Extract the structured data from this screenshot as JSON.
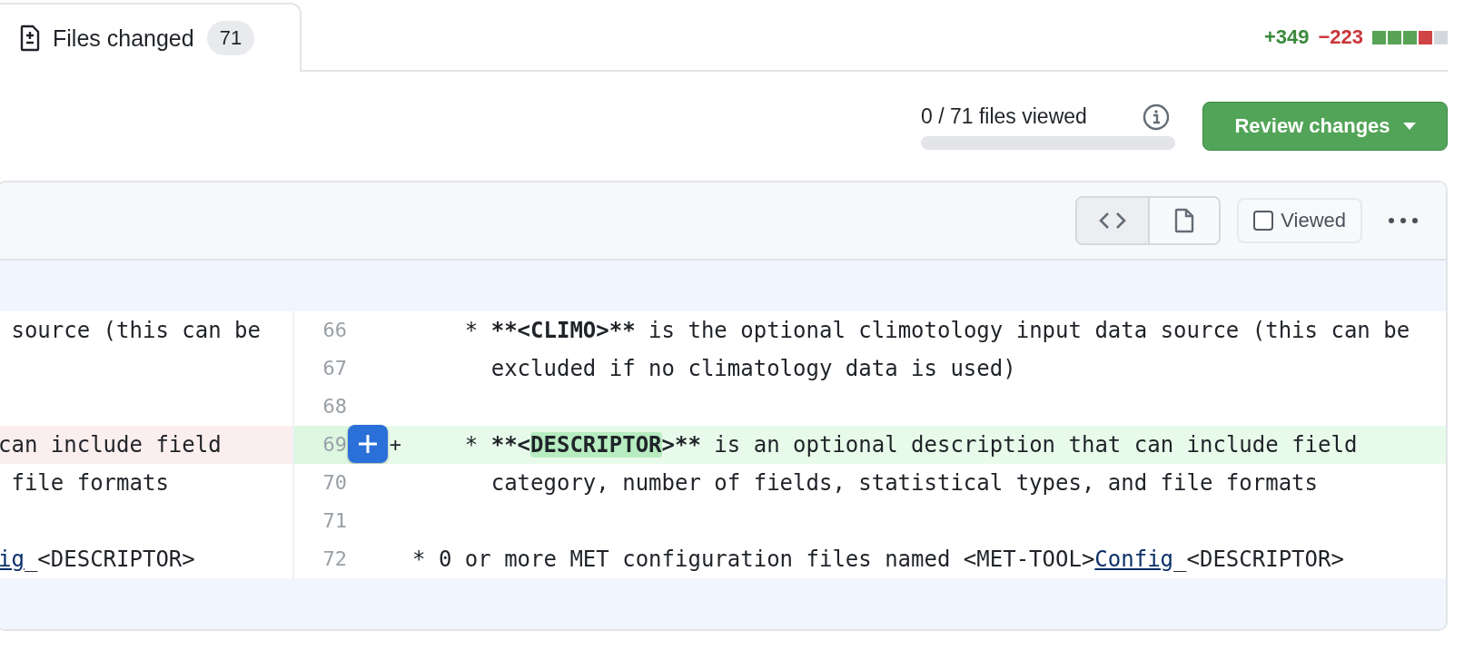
{
  "tab": {
    "label": "Files changed",
    "count": "71",
    "selected": true
  },
  "diffstat": {
    "added": "+349",
    "removed": "−223",
    "blocks": [
      {
        "color": "#57a457"
      },
      {
        "color": "#57a457"
      },
      {
        "color": "#57a457"
      },
      {
        "color": "#cf4547"
      },
      {
        "color": "#d4d8dd"
      }
    ]
  },
  "progress": {
    "label": "0 / 71 files viewed",
    "level": 0
  },
  "review_button": {
    "label": "Review changes"
  },
  "file_header": {
    "view_toggle": [
      {
        "kind": "code",
        "selected": true
      },
      {
        "kind": "file",
        "selected": false
      }
    ],
    "viewed": {
      "label": "Viewed",
      "checked": false
    }
  },
  "rows": [
    {
      "number": "66",
      "kind": "context",
      "hovered": false,
      "left": [
        {
          "kind": "plain",
          "text": " source (this can be"
        }
      ],
      "right": [
        {
          "kind": "plain",
          "text": "    * "
        },
        {
          "kind": "strong",
          "text": "**<CLIMO>**"
        },
        {
          "kind": "plain",
          "text": " is the optional climotology input data source (this can be"
        }
      ]
    },
    {
      "number": "67",
      "kind": "context",
      "hovered": false,
      "right": [
        {
          "kind": "plain",
          "text": "      excluded if no climatology data is used)"
        }
      ]
    },
    {
      "number": "68",
      "kind": "context",
      "hovered": false
    },
    {
      "number": "69",
      "kind": "changed",
      "hovered": true,
      "marker": "+",
      "left": [
        {
          "kind": "plain",
          "text": "can include field"
        }
      ],
      "right": [
        {
          "kind": "plain",
          "text": "    * "
        },
        {
          "kind": "strong",
          "text": "**<"
        },
        {
          "kind": "changed",
          "text": "DESCRIPTOR"
        },
        {
          "kind": "strong",
          "text": ">**"
        },
        {
          "kind": "plain",
          "text": " is an optional description that can include field"
        }
      ]
    },
    {
      "number": "70",
      "kind": "context",
      "hovered": false,
      "left": [
        {
          "kind": "plain",
          "text": " file formats"
        }
      ],
      "right": [
        {
          "kind": "plain",
          "text": "      category, number of fields, statistical types, and file formats"
        }
      ]
    },
    {
      "number": "71",
      "kind": "context",
      "hovered": false
    },
    {
      "number": "72",
      "kind": "context",
      "hovered": false,
      "left": [
        {
          "kind": "link",
          "text": "ig"
        },
        {
          "kind": "plain",
          "text": "_<DESCRIPTOR>"
        }
      ],
      "right": [
        {
          "kind": "plain",
          "text": "* 0 or more MET configuration files named <MET-TOOL>"
        },
        {
          "kind": "link",
          "text": "Config"
        },
        {
          "kind": "plain",
          "text": "_<DESCRIPTOR>"
        }
      ]
    }
  ]
}
